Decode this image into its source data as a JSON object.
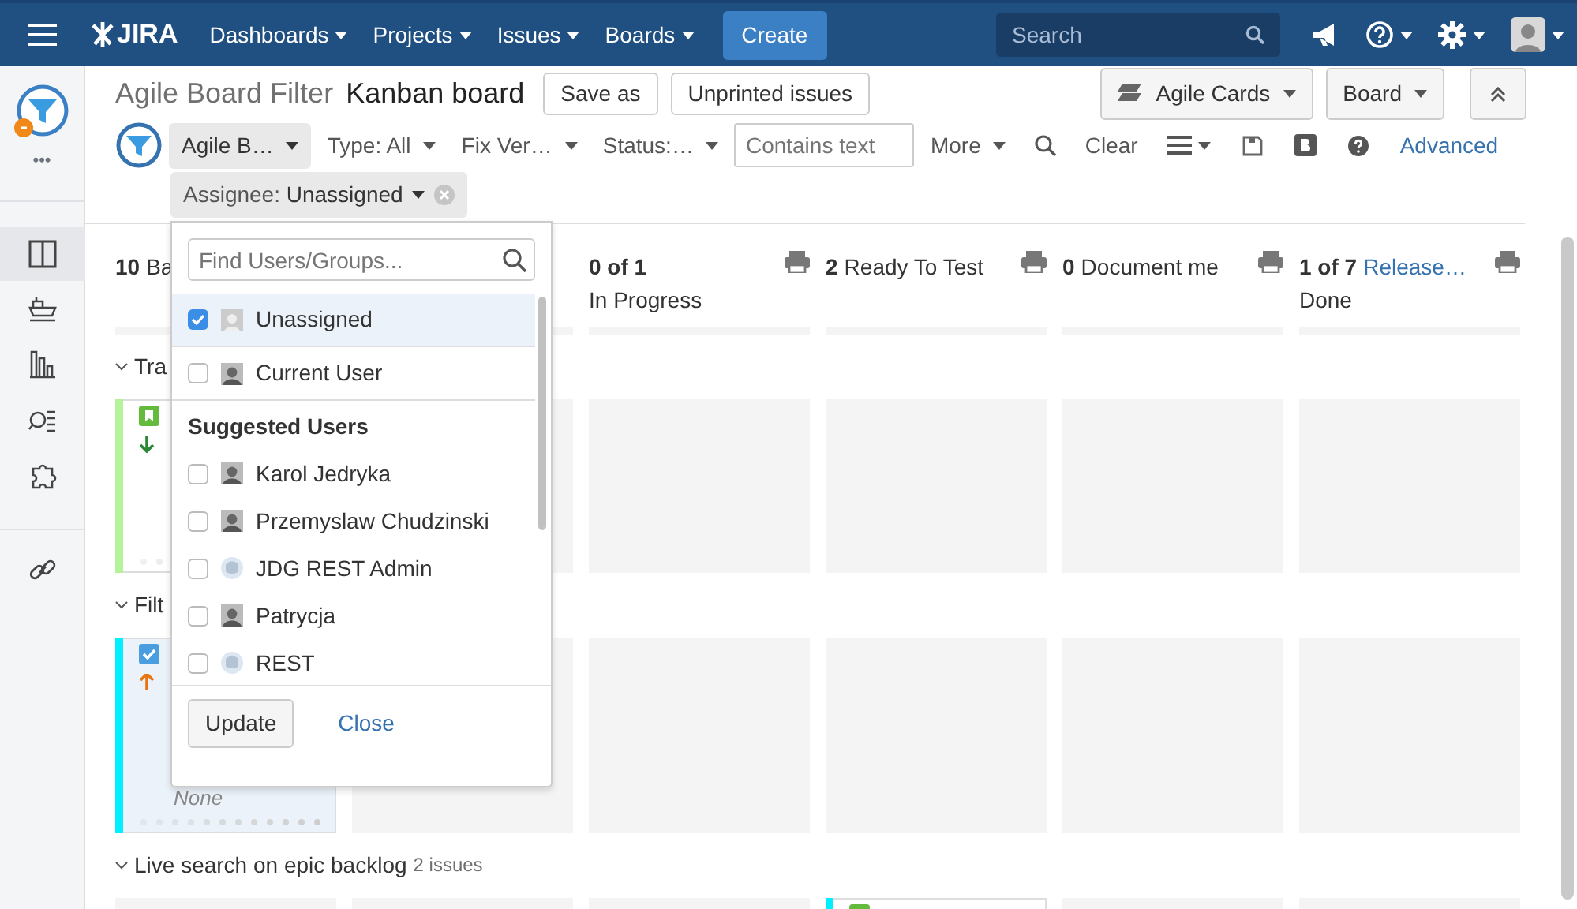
{
  "navbar": {
    "logo": "JIRA",
    "menus": [
      {
        "label": "Dashboards"
      },
      {
        "label": "Projects"
      },
      {
        "label": "Issues"
      },
      {
        "label": "Boards"
      }
    ],
    "create": "Create",
    "search": {
      "placeholder": "Search"
    }
  },
  "sidebar": {
    "items": [
      {
        "selected": true
      },
      {
        "selected": false
      },
      {
        "selected": false
      },
      {
        "selected": false
      },
      {
        "selected": false
      }
    ],
    "more": "•••"
  },
  "header": {
    "title": "Agile Board Filter",
    "board": "Kanban board",
    "buttons": [
      "Save as",
      "Unprinted issues"
    ],
    "right_buttons": [
      {
        "label": "Agile Cards",
        "icon": true
      },
      {
        "label": "Board",
        "icon": false
      }
    ]
  },
  "filters": [
    {
      "kind": "dropdown",
      "label": "Agile B…",
      "active": true
    },
    {
      "kind": "dropdown",
      "label": "Type: All",
      "active": false
    },
    {
      "kind": "dropdown",
      "label": "Fix Ver…",
      "active": false
    },
    {
      "kind": "dropdown",
      "label": "Status:…",
      "active": false
    },
    {
      "kind": "text",
      "placeholder": "Contains text"
    },
    {
      "kind": "dropdown",
      "label": "More",
      "active": false
    },
    {
      "kind": "search"
    },
    {
      "kind": "plain",
      "label": "Clear"
    },
    {
      "kind": "menu"
    },
    {
      "kind": "save"
    },
    {
      "kind": "bold"
    },
    {
      "kind": "help"
    },
    {
      "kind": "link",
      "label": "Advanced"
    }
  ],
  "chip": {
    "label": "Assignee:",
    "value": "Unassigned"
  },
  "columns": [
    {
      "count": "10",
      "name": "Ba"
    },
    {
      "count": "0 of 1",
      "second": "In Progress"
    },
    {
      "count": "2",
      "name": "Ready To Test"
    },
    {
      "count": "0",
      "name": "Document me"
    },
    {
      "count": "1 of 7",
      "link": "Release…",
      "second": "Done"
    }
  ],
  "swimlanes": [
    {
      "title": "Tra",
      "cells": [
        {
          "kind": "card",
          "color": "#b3f39a",
          "type_icon": {
            "kind": "story"
          },
          "priority": {
            "kind": "low"
          },
          "selected": false
        },
        {
          "kind": "empty"
        },
        {
          "kind": "empty"
        },
        {
          "kind": "empty"
        },
        {
          "kind": "empty"
        },
        {
          "kind": "empty"
        }
      ]
    },
    {
      "title": "Filt",
      "cells": [
        {
          "kind": "card",
          "color": "#00f0ff",
          "type_icon": {
            "kind": "task"
          },
          "priority": {
            "kind": "high"
          },
          "selected": true,
          "assignee": "None"
        },
        {
          "kind": "empty"
        },
        {
          "kind": "empty"
        },
        {
          "kind": "empty"
        },
        {
          "kind": "empty"
        },
        {
          "kind": "empty"
        }
      ]
    },
    {
      "title": "Live search on epic backlog",
      "count": "2 issues",
      "cells": [
        {
          "kind": "empty"
        },
        {
          "kind": "empty"
        },
        {
          "kind": "empty"
        },
        {
          "kind": "card",
          "color": "#00f0ff",
          "type_icon": {
            "kind": "story"
          },
          "selected": false
        },
        {
          "kind": "empty"
        },
        {
          "kind": "empty"
        }
      ]
    }
  ],
  "user_picker": {
    "placeholder": "Find Users/Groups...",
    "items": [
      {
        "kind": "user",
        "label": "Unassigned",
        "avatar": {
          "kind": "blank"
        },
        "checked": true,
        "selected": true
      },
      {
        "kind": "user",
        "label": "Current User",
        "avatar": {
          "kind": "photo"
        },
        "checked": false,
        "selected": false
      },
      {
        "kind": "heading",
        "label": "Suggested Users"
      },
      {
        "kind": "user",
        "label": "Karol Jedryka",
        "avatar": {
          "kind": "photo"
        },
        "checked": false,
        "selected": false
      },
      {
        "kind": "user",
        "label": "Przemyslaw Chudzinski",
        "avatar": {
          "kind": "photo"
        },
        "checked": false,
        "selected": false
      },
      {
        "kind": "user",
        "label": "JDG REST Admin",
        "avatar": {
          "kind": "round"
        },
        "checked": false,
        "selected": false
      },
      {
        "kind": "user",
        "label": "Patrycja",
        "avatar": {
          "kind": "photo"
        },
        "checked": false,
        "selected": false
      },
      {
        "kind": "user",
        "label": "REST",
        "avatar": {
          "kind": "round"
        },
        "checked": false,
        "selected": false
      }
    ],
    "update": "Update",
    "close": "Close"
  }
}
